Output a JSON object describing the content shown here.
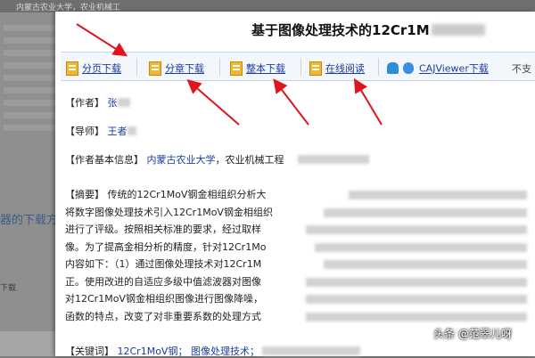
{
  "background": {
    "top_text": "内蒙古农业大学，农业机械工",
    "side_link": "器的下载方",
    "footer_label": "下载"
  },
  "modal": {
    "title": "基于图像处理技术的12Cr1M",
    "toolbar": {
      "items": [
        {
          "label": "分页下载"
        },
        {
          "label": "分章下载"
        },
        {
          "label": "整本下载"
        },
        {
          "label": "在线阅读"
        }
      ],
      "cajviewer": "CAJViewer下载",
      "extra": "不支"
    },
    "author": {
      "label": "【作者】",
      "value": "张"
    },
    "tutor": {
      "label": "【导师】",
      "value": "王者"
    },
    "info": {
      "label": "【作者基本信息】",
      "school": "内蒙古农业大学",
      "dept": "，农业机械工程"
    },
    "abstract": {
      "label": "【摘要】",
      "lines": [
        "传统的12Cr1MoV钢金相组织分析大",
        "将数字图像处理技术引入12Cr1MoV钢金相组织",
        "进行了评级。按照相关标准的要求，经过取样",
        "像。为了提高金相分析的精度，针对12Cr1Mo",
        "内容如下：（1）通过图像处理技术对12Cr1M",
        "正。使用改进的自适应多级中值滤波器对图像",
        "对12Cr1MoV钢金相组织图像进行图像降噪，",
        "函数的特点，改变了对非重要系数的处理方式"
      ]
    },
    "keywords": {
      "label": "【关键词】",
      "k1": "12Cr1MoV钢；",
      "k2": "图像处理技术；"
    }
  },
  "watermark": "头条 @范翠儿呀",
  "colors": {
    "link": "#1a3d9c",
    "arrow": "#e0141e",
    "toolbar_bg": "#f3f6fa"
  }
}
